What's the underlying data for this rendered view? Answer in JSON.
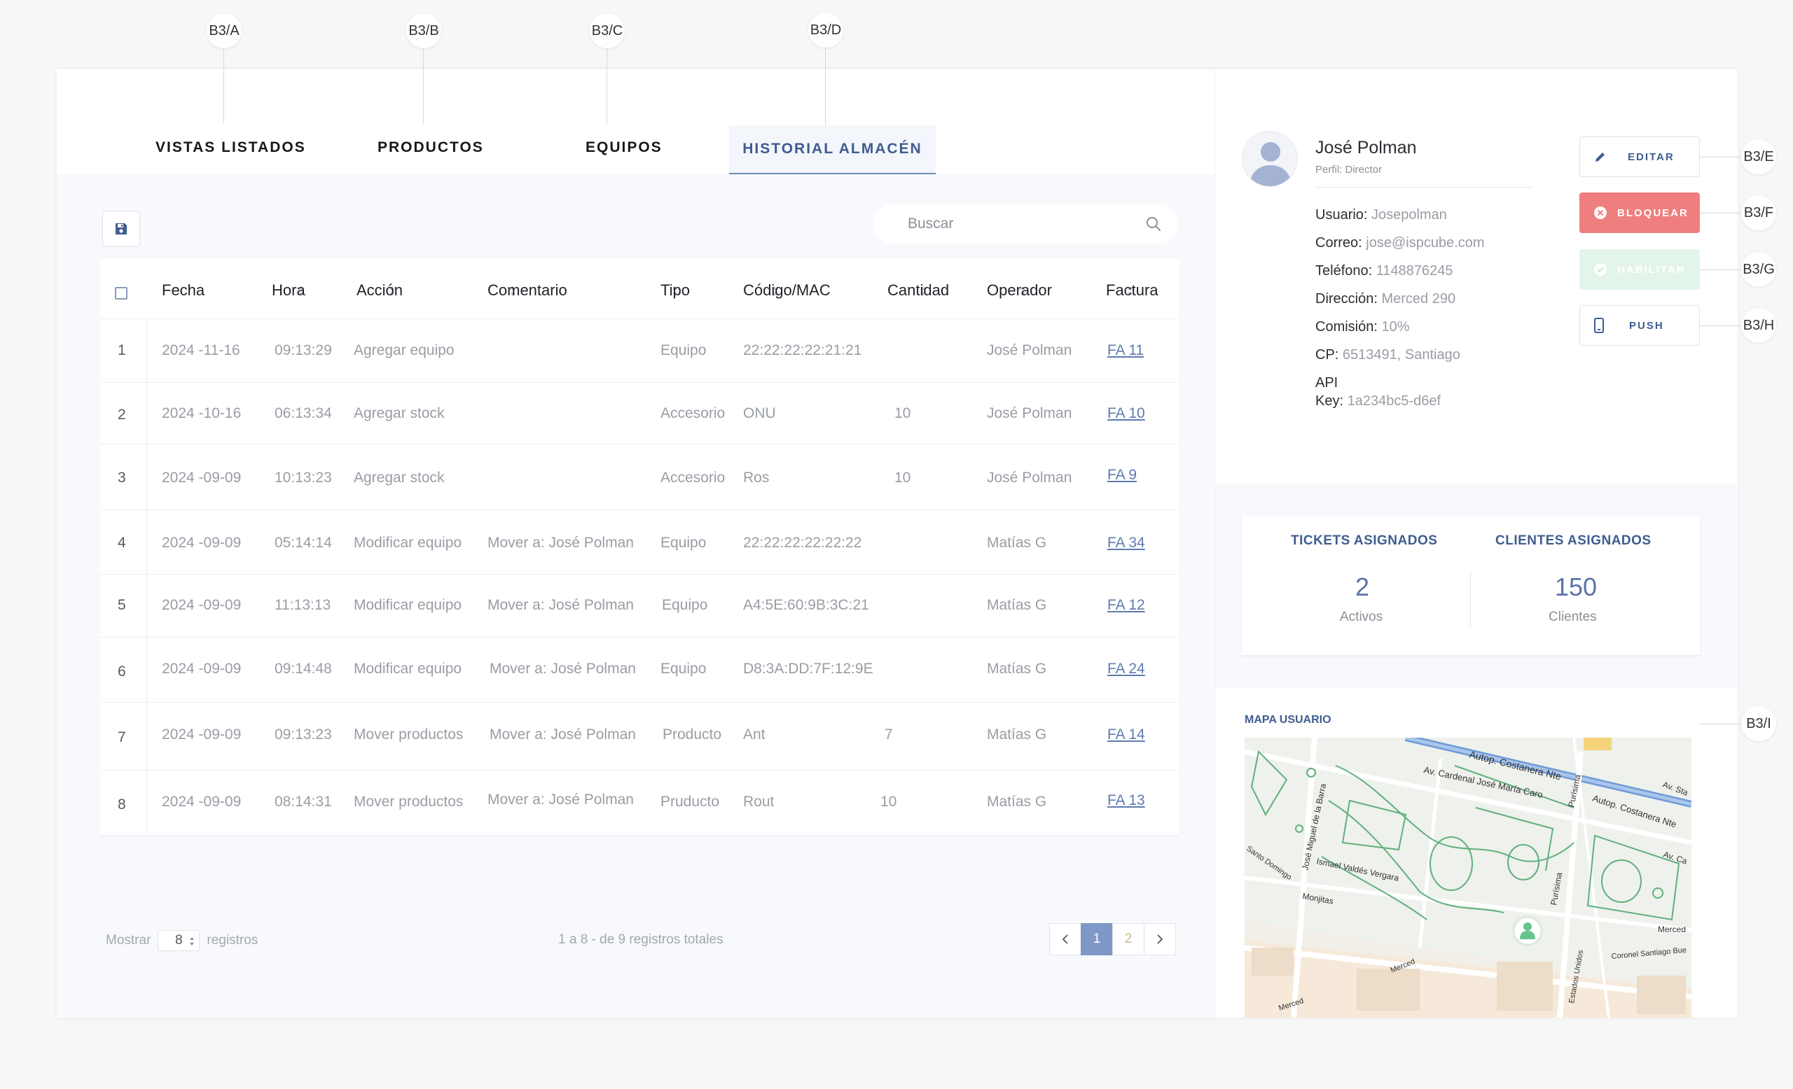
{
  "callouts": [
    "B3/A",
    "B3/B",
    "B3/C",
    "B3/D",
    "B3/E",
    "B3/F",
    "B3/G",
    "B3/H",
    "B3/I"
  ],
  "tabs": [
    {
      "label": "VISTAS LISTADOS"
    },
    {
      "label": "PRODUCTOS"
    },
    {
      "label": "EQUIPOS"
    },
    {
      "label": "HISTORIAL ALMACÉN",
      "active": true
    }
  ],
  "toolbar": {
    "save_icon": "floppy-disk-icon",
    "search_placeholder": "Buscar",
    "search_icon": "magnifier-icon"
  },
  "table": {
    "columns": [
      "Fecha",
      "Hora",
      "Acción",
      "Comentario",
      "Tipo",
      "Código/MAC",
      "Cantidad",
      "Operador",
      "Factura"
    ],
    "rows": [
      {
        "n": "1",
        "fecha": "2024 -11-16",
        "hora": "09:13:29",
        "accion": "Agregar equipo",
        "comentario": "",
        "tipo": "Equipo",
        "codigo": "22:22:22:22:21:21",
        "cantidad": "",
        "operador": "José Polman",
        "factura": "FA 11"
      },
      {
        "n": "2",
        "fecha": "2024 -10-16",
        "hora": "06:13:34",
        "accion": "Agregar stock",
        "comentario": "",
        "tipo": "Accesorio",
        "codigo": "ONU",
        "cantidad": "10",
        "operador": "José Polman",
        "factura": "FA 10"
      },
      {
        "n": "3",
        "fecha": "2024 -09-09",
        "hora": "10:13:23",
        "accion": "Agregar stock",
        "comentario": "",
        "tipo": "Accesorio",
        "codigo": "Ros",
        "cantidad": "10",
        "operador": "José Polman",
        "factura": "FA 9"
      },
      {
        "n": "4",
        "fecha": "2024 -09-09",
        "hora": "05:14:14",
        "accion": "Modificar equipo",
        "comentario": "Mover a: José Polman",
        "tipo": "Equipo",
        "codigo": "22:22:22:22:22:22",
        "cantidad": "",
        "operador": "Matías G",
        "factura": "FA 34"
      },
      {
        "n": "5",
        "fecha": "2024 -09-09",
        "hora": "11:13:13",
        "accion": "Modificar equipo",
        "comentario": "Mover a: José Polman",
        "tipo": "Equipo",
        "codigo": "A4:5E:60:9B:3C:21",
        "cantidad": "",
        "operador": "Matías G",
        "factura": "FA 12"
      },
      {
        "n": "6",
        "fecha": "2024 -09-09",
        "hora": "09:14:48",
        "accion": "Modificar equipo",
        "comentario": "Mover a: José Polman",
        "tipo": "Equipo",
        "codigo": "D8:3A:DD:7F:12:9E",
        "cantidad": "",
        "operador": "Matías G",
        "factura": "FA 24"
      },
      {
        "n": "7",
        "fecha": "2024 -09-09",
        "hora": "09:13:23",
        "accion": "Mover productos",
        "comentario": "Mover a: José Polman",
        "tipo": "Producto",
        "codigo": "Ant",
        "cantidad": "7",
        "operador": "Matías G",
        "factura": "FA 14"
      },
      {
        "n": "8",
        "fecha": "2024 -09-09",
        "hora": "08:14:31",
        "accion": "Mover productos",
        "comentario": "Mover a: José Polman",
        "tipo": "Pruducto",
        "codigo": "Rout",
        "cantidad": "10",
        "operador": "Matías G",
        "factura": "FA 13"
      }
    ]
  },
  "footer": {
    "show_label": "Mostrar",
    "show_value": "8",
    "records_label": "registros",
    "summary": "1 a 8  - de 9 registros totales",
    "pages": [
      "1",
      "2"
    ],
    "current_page": "1"
  },
  "profile": {
    "name": "José Polman",
    "role": "Perfil: Director",
    "fields": [
      {
        "label": "Usuario:",
        "value": "Josepolman"
      },
      {
        "label": "Correo:",
        "value": "jose@ispcube.com"
      },
      {
        "label": "Teléfono:",
        "value": "1148876245"
      },
      {
        "label": "Dirección:",
        "value": "Merced 290"
      },
      {
        "label": "Comisión:",
        "value": "10%"
      },
      {
        "label": "CP:",
        "value": "6513491, Santiago"
      }
    ],
    "api_label_1": "API",
    "api_label_2": "Key:",
    "api_value": "1a234bc5-d6ef"
  },
  "actions": {
    "edit": {
      "label": "EDITAR",
      "icon": "pencil-icon"
    },
    "block": {
      "label": "BLOQUEAR",
      "icon": "x-circle-icon",
      "color": "#ee7f7e"
    },
    "enable": {
      "label": "HABILITAR",
      "icon": "check-circle-icon",
      "color": "#e3f4ea"
    },
    "push": {
      "label": "PUSH",
      "icon": "mobile-phone-icon"
    }
  },
  "stats": {
    "tickets_title": "TICKETS ASIGNADOS",
    "tickets_value": "2",
    "tickets_sub": "Activos",
    "clients_title": "CLIENTES ASIGNADOS",
    "clients_value": "150",
    "clients_sub": "Clientes"
  },
  "map": {
    "title": "MAPA USUARIO",
    "labels": [
      "Autop. Costanera Nte",
      "Av. Cardenal José María Caro",
      "Av. Sta",
      "Autop. Costanera Nte",
      "Purísima",
      "José Miguel de la Barra",
      "Santo Domingo",
      "Ismael Valdés Vergara",
      "Monjitas",
      "Purísima",
      "Av. Ca",
      "Merced",
      "Coronel Santiago Bue",
      "Merced",
      "Estados Unidos",
      "Merced"
    ],
    "pin_icon": "user-pin-icon"
  },
  "colors": {
    "accent": "#3f5c8f",
    "danger": "#ee7f7e",
    "success_light": "#e3f4ea",
    "page_active": "#7f98c6"
  }
}
